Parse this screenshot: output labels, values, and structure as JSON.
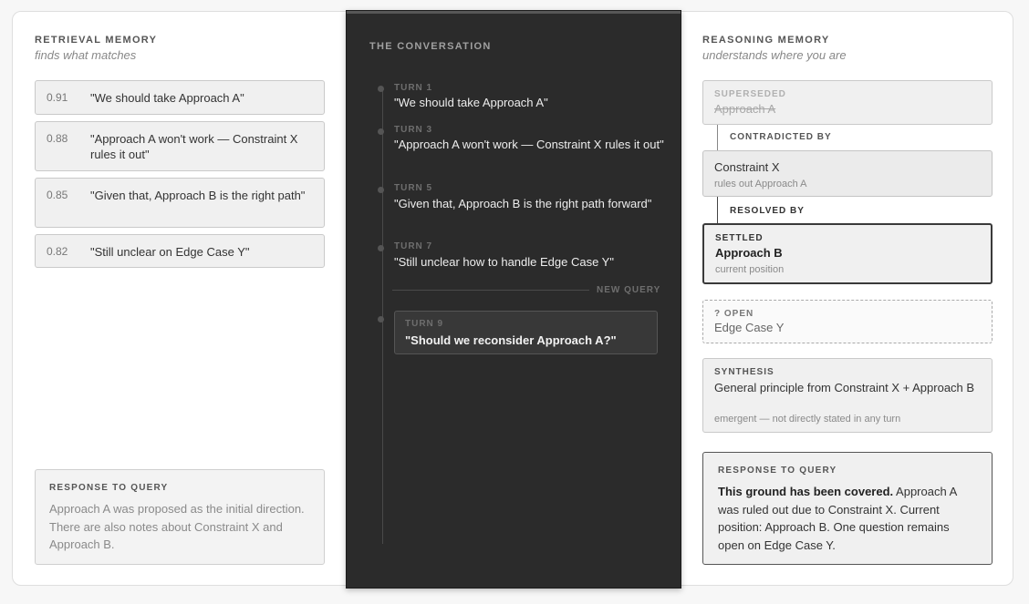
{
  "retrieval": {
    "title": "RETRIEVAL MEMORY",
    "subtitle": "finds what matches",
    "items": [
      {
        "score": "0.91",
        "text": "\"We should take Approach A\""
      },
      {
        "score": "0.88",
        "text": "\"Approach A won't work — Constraint X rules it out\""
      },
      {
        "score": "0.85",
        "text": "\"Given that, Approach B is the right path\""
      },
      {
        "score": "0.82",
        "text": "\"Still unclear on Edge Case Y\""
      }
    ],
    "response": {
      "label": "RESPONSE TO QUERY",
      "body": "Approach A was proposed as the initial direction. There are also notes about Constraint X and Approach B."
    }
  },
  "conversation": {
    "title": "THE CONVERSATION",
    "turns": [
      {
        "label": "TURN 1",
        "text": "\"We should take Approach A\""
      },
      {
        "label": "TURN 3",
        "text": "\"Approach A won't work — Constraint X rules it out\""
      },
      {
        "label": "TURN 5",
        "text": "\"Given that, Approach B is the right path forward\""
      },
      {
        "label": "TURN 7",
        "text": "\"Still unclear how to handle Edge Case Y\""
      }
    ],
    "new_query_label": "NEW QUERY",
    "query": {
      "label": "TURN 9",
      "text": "\"Should we reconsider Approach A?\""
    }
  },
  "reasoning": {
    "title": "REASONING MEMORY",
    "subtitle": "understands where you are",
    "superseded": {
      "label": "SUPERSEDED",
      "main": "Approach A"
    },
    "contradicted_by": "CONTRADICTED BY",
    "constraint": {
      "main": "Constraint X",
      "sub": "rules out Approach A"
    },
    "resolved_by": "RESOLVED BY",
    "settled": {
      "label": "SETTLED",
      "main": "Approach B",
      "sub": "current position"
    },
    "open": {
      "label": "? OPEN",
      "main": "Edge Case Y"
    },
    "synthesis": {
      "label": "SYNTHESIS",
      "main": "General principle from Constraint X + Approach B",
      "sub": "emergent — not directly stated in any turn"
    },
    "response": {
      "label": "RESPONSE TO QUERY",
      "lead": "This ground has been covered.",
      "body": " Approach A was ruled out due to Constraint X. Current position: Approach B. One question remains open on Edge Case Y."
    }
  }
}
